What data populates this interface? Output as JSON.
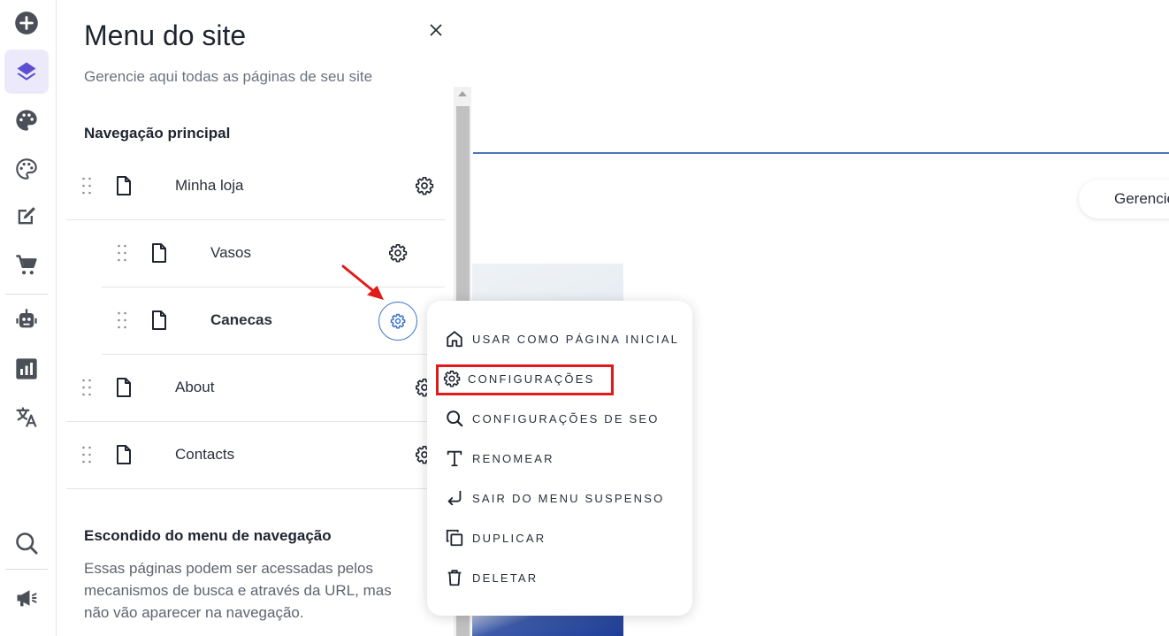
{
  "panel": {
    "title": "Menu do site",
    "subtitle": "Gerencie aqui todas as páginas de seu site"
  },
  "main_nav": {
    "title": "Navegação principal",
    "items": [
      {
        "label": "Minha loja"
      },
      {
        "label": "Vasos"
      },
      {
        "label": "Canecas"
      },
      {
        "label": "About"
      },
      {
        "label": "Contacts"
      }
    ]
  },
  "hidden_nav": {
    "title": "Escondido do menu de navegação",
    "description": "Essas páginas podem ser acessadas pelos mecanismos de busca e através da URL, mas não vão aparecer na navegação."
  },
  "canvas": {
    "manage_button": "Gerencie"
  },
  "context_menu": {
    "items": [
      {
        "label": "USAR COMO PÁGINA INICIAL",
        "icon": "home-icon"
      },
      {
        "label": "CONFIGURAÇÕES",
        "icon": "gear-icon"
      },
      {
        "label": "CONFIGURAÇÕES DE SEO",
        "icon": "search-icon"
      },
      {
        "label": "RENOMEAR",
        "icon": "text-icon"
      },
      {
        "label": "SAIR DO MENU SUSPENSO",
        "icon": "return-arrow-icon"
      },
      {
        "label": "DUPLICAR",
        "icon": "duplicate-icon"
      },
      {
        "label": "DELETAR",
        "icon": "trash-icon"
      }
    ]
  },
  "colors": {
    "accent": "#3b73c8",
    "active_rail": "#ece9fb",
    "layers_icon": "#5b4ed1",
    "highlight": "#e01b1b"
  }
}
